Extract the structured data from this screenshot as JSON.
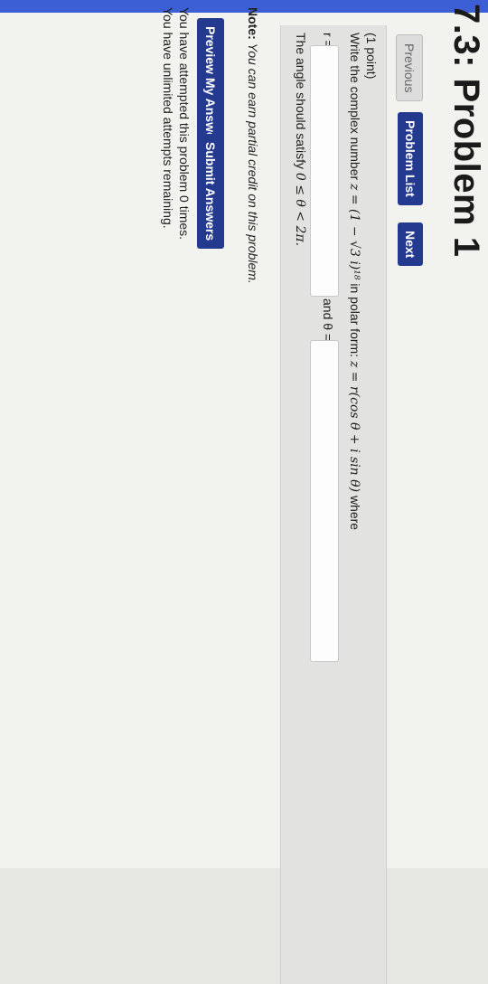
{
  "page": {
    "title": "7.3: Problem 1"
  },
  "nav": {
    "previous": "Previous",
    "problem_list": "Problem List",
    "next": "Next"
  },
  "problem": {
    "points": "(1 point)",
    "question_prefix": "Write the complex number",
    "question_math": "z = (1 − √3 i)¹⁸",
    "question_mid": "in polar form:",
    "polar_form": "z = r(cos θ + i sin θ)",
    "question_suffix": "where",
    "r_label": "r =",
    "and_theta_label": "and θ =",
    "angle_condition_prefix": "The angle should satisfy",
    "angle_condition": "0 ≤ θ < 2π."
  },
  "note": {
    "bold": "Note:",
    "text": "You can earn partial credit on this problem."
  },
  "actions": {
    "preview": "Preview My Answers",
    "submit": "Submit Answers"
  },
  "status": {
    "attempted": "You have attempted this problem 0 times.",
    "remaining": "You have unlimited attempts remaining."
  }
}
